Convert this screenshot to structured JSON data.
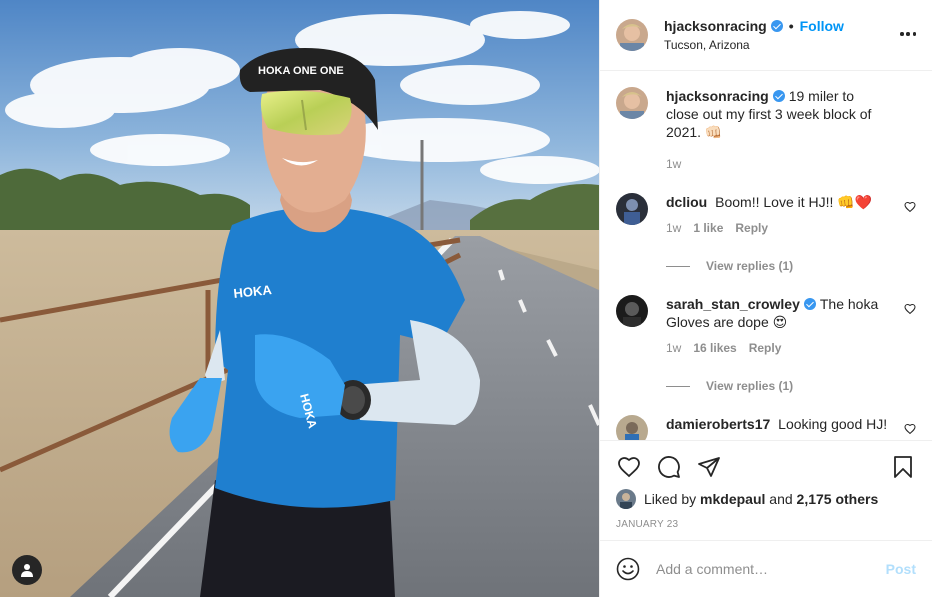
{
  "post": {
    "author": "hjacksonracing",
    "location": "Tucson, Arizona",
    "follow_label": "Follow",
    "separator": "•"
  },
  "caption": {
    "user": "hjacksonracing",
    "text": "19 miler to close out my first 3 week block of 2021. 👊🏻",
    "time": "1w"
  },
  "comments": [
    {
      "user": "dcliou",
      "verified": false,
      "text": "Boom!! Love it HJ!! 👊❤️",
      "time": "1w",
      "likes": "1 like",
      "reply": "Reply",
      "view_replies": "View replies (1)"
    },
    {
      "user": "sarah_stan_crowley",
      "verified": true,
      "text": "The hoka Gloves are dope 😍",
      "time": "1w",
      "likes": "16 likes",
      "reply": "Reply",
      "view_replies": "View replies (1)"
    },
    {
      "user": "damieroberts17",
      "verified": false,
      "text": "Looking good HJ!"
    }
  ],
  "likes": {
    "prefix": "Liked by",
    "user": "mkdepaul",
    "middle": "and",
    "others": "2,175 others"
  },
  "date": "JANUARY 23",
  "comment_box": {
    "placeholder": "Add a comment…",
    "post_label": "Post"
  },
  "photo_text": {
    "cap_brand": "HOKA ONE ONE",
    "shirt_brand": "HOKA",
    "glove_brand": "HOKA"
  },
  "colors": {
    "accent": "#0095f6",
    "verified": "#3897f0",
    "muted": "#8e8e8e",
    "post_disabled": "#b2dffc"
  },
  "icons": [
    "user-tag-icon",
    "more-options-icon",
    "heart-icon",
    "comment-icon",
    "share-icon",
    "bookmark-icon",
    "emoji-icon",
    "verified-badge-icon"
  ]
}
